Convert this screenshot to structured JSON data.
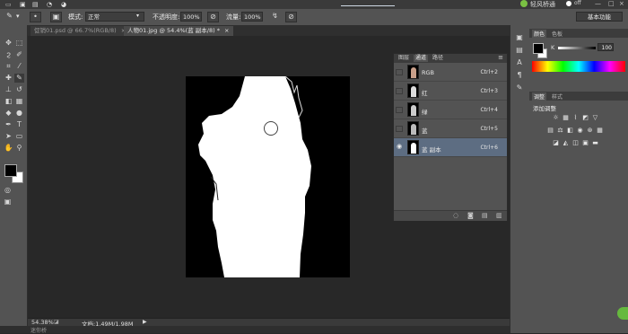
{
  "menubar": {
    "items": [
      "🖌 ▾",
      "◘ ▾",
      "▣",
      "模式:",
      "正常",
      "不透明度:",
      "100%",
      "流量:",
      "100%"
    ],
    "status": {
      "brand": "轻风桥通",
      "toggle": "off"
    }
  },
  "options": {
    "mode_label": "模式:",
    "mode_value": "正常",
    "opacity_label": "不透明度:",
    "opacity_value": "100%",
    "flow_label": "流量:",
    "flow_value": "100%",
    "workspace": "基本功能"
  },
  "tabs": [
    {
      "label": "促销01.psd @ 66.7%(RGB/8)",
      "close": "×",
      "active": false
    },
    {
      "label": "人物01.jpg @ 54.4%(蓝 副本/8) *",
      "close": "×",
      "active": true
    }
  ],
  "status_bar": {
    "zoom": "54.38%",
    "doc_info": "文档:1.49M/1.98M",
    "arrow": "▶"
  },
  "bottom_bar": {
    "label": "迷你桥"
  },
  "channels_panel": {
    "tabs": [
      "图层",
      "通道",
      "路径"
    ],
    "active_tab": "通道",
    "rows": [
      {
        "name": "RGB",
        "key": "Ctrl+2",
        "visible": false,
        "selected": false
      },
      {
        "name": "红",
        "key": "Ctrl+3",
        "visible": false,
        "selected": false
      },
      {
        "name": "绿",
        "key": "Ctrl+4",
        "visible": false,
        "selected": false
      },
      {
        "name": "蓝",
        "key": "Ctrl+5",
        "visible": false,
        "selected": false
      },
      {
        "name": "蓝 副本",
        "key": "Ctrl+6",
        "visible": true,
        "selected": true
      }
    ],
    "footer_icons": [
      "dotted-circle-icon",
      "mask-icon",
      "new-channel-icon",
      "trash-icon"
    ]
  },
  "color_panel": {
    "tabs": [
      "颜色",
      "色板"
    ],
    "active_tab": "颜色",
    "channel_label": "K",
    "value": "100"
  },
  "adjustments_panel": {
    "tabs": [
      "调整",
      "样式"
    ],
    "active_tab": "调整",
    "title": "添加调整"
  },
  "colors": {
    "panel": "#535353",
    "selected_row": "#5d6d82",
    "canvas_bg": "#282828",
    "image_bg": "#000000"
  }
}
